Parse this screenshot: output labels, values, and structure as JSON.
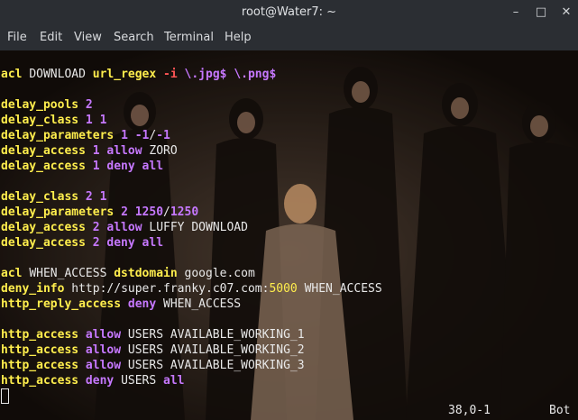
{
  "window": {
    "title": "root@Water7: ~",
    "min_icon": "minimize-icon",
    "max_icon": "maximize-icon",
    "close_icon": "close-icon",
    "min_glyph": "–",
    "max_glyph": "□",
    "close_glyph": "✕"
  },
  "menu": [
    "File",
    "Edit",
    "View",
    "Search",
    "Terminal",
    "Help"
  ],
  "lines": [
    [
      [
        "acl ",
        "k"
      ],
      [
        "DOWNLOAD ",
        ""
      ],
      [
        "url_regex ",
        "k"
      ],
      [
        "-i ",
        "r"
      ],
      [
        "\\.jpg$ \\.png$",
        "p"
      ]
    ],
    [],
    [
      [
        "delay_pools ",
        "k"
      ],
      [
        "2",
        "p"
      ]
    ],
    [
      [
        "delay_class ",
        "k"
      ],
      [
        "1 1",
        "p"
      ]
    ],
    [
      [
        "delay_parameters ",
        "k"
      ],
      [
        "1 -1",
        "p"
      ],
      [
        "/",
        ""
      ],
      [
        "-1",
        "p"
      ]
    ],
    [
      [
        "delay_access ",
        "k"
      ],
      [
        "1 allow ",
        "p"
      ],
      [
        "ZORO",
        ""
      ]
    ],
    [
      [
        "delay_access ",
        "k"
      ],
      [
        "1 deny all",
        "p"
      ]
    ],
    [],
    [
      [
        "delay_class ",
        "k"
      ],
      [
        "2 1",
        "p"
      ]
    ],
    [
      [
        "delay_parameters ",
        "k"
      ],
      [
        "2 1250",
        "p"
      ],
      [
        "/",
        ""
      ],
      [
        "1250",
        "p"
      ]
    ],
    [
      [
        "delay_access ",
        "k"
      ],
      [
        "2 allow ",
        "p"
      ],
      [
        "LUFFY DOWNLOAD",
        ""
      ]
    ],
    [
      [
        "delay_access ",
        "k"
      ],
      [
        "2 deny all",
        "p"
      ]
    ],
    [],
    [
      [
        "acl ",
        "k"
      ],
      [
        "WHEN_ACCESS ",
        ""
      ],
      [
        "dstdomain ",
        "k"
      ],
      [
        "google.com",
        ""
      ]
    ],
    [
      [
        "deny_info ",
        "k"
      ],
      [
        "http://super.franky.c07.com:",
        ""
      ],
      [
        "5000",
        "",
        " port"
      ],
      [
        " WHEN_ACCESS",
        ""
      ]
    ],
    [
      [
        "http_reply_access ",
        "k"
      ],
      [
        "deny ",
        "p"
      ],
      [
        "WHEN_ACCESS",
        ""
      ]
    ],
    [],
    [
      [
        "http_access ",
        "k"
      ],
      [
        "allow ",
        "p"
      ],
      [
        "USERS AVAILABLE_WORKING_1",
        ""
      ]
    ],
    [
      [
        "http_access ",
        "k"
      ],
      [
        "allow ",
        "p"
      ],
      [
        "USERS AVAILABLE_WORKING_2",
        ""
      ]
    ],
    [
      [
        "http_access ",
        "k"
      ],
      [
        "allow ",
        "p"
      ],
      [
        "USERS AVAILABLE_WORKING_3",
        ""
      ]
    ],
    [
      [
        "http_access ",
        "k"
      ],
      [
        "deny ",
        "p"
      ],
      [
        "USERS ",
        ""
      ],
      [
        "all",
        "p"
      ]
    ]
  ],
  "status": {
    "position": "38,0-1",
    "scroll": "Bot"
  }
}
